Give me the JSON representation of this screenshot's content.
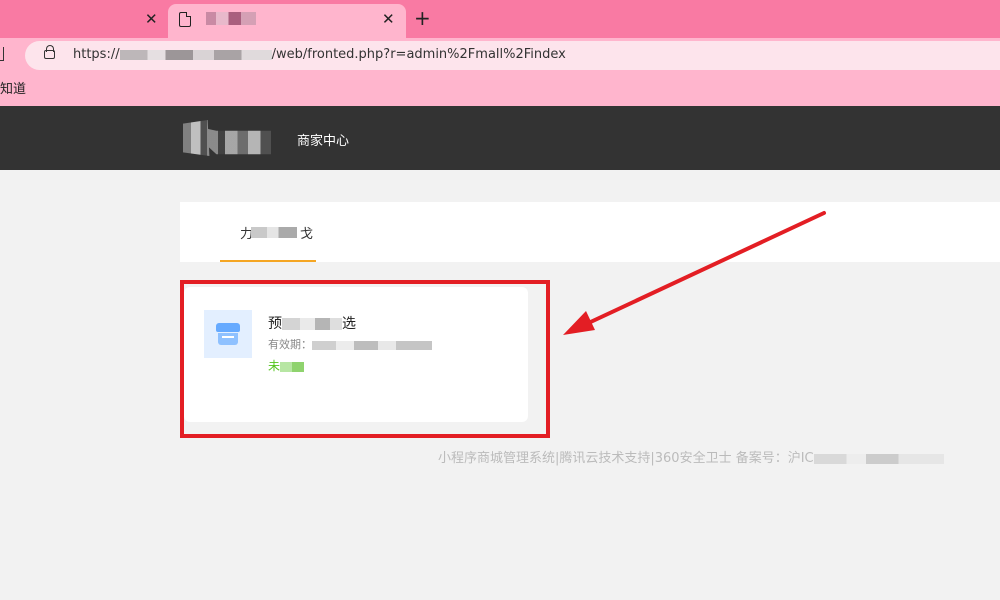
{
  "browser": {
    "tabs": [
      {
        "close": "✕"
      },
      {
        "close": "✕"
      }
    ],
    "new_tab": "+",
    "url_prefix": "https://",
    "url_suffix": "/web/fronted.php?r=admin%2Fmall%2Findex",
    "bookmark": "知道"
  },
  "header": {
    "nav": "商家中心"
  },
  "tabs": [
    {
      "label_start": "力",
      "label_end": "戈"
    }
  ],
  "card": {
    "title_start": "预",
    "title_end": "选",
    "validity_label": "有效期：",
    "status_start": "未"
  },
  "footer": {
    "text": "小程序商城管理系统|腾讯云技术支持|360安全卫士 备案号：沪IC"
  },
  "colors": {
    "tab_strip": "#f97aa3",
    "toolbar": "#ffb5cd",
    "header": "#333333",
    "tab_underline": "#f5a623",
    "status_green": "#52c41a",
    "annotation_red": "#e31e24"
  }
}
